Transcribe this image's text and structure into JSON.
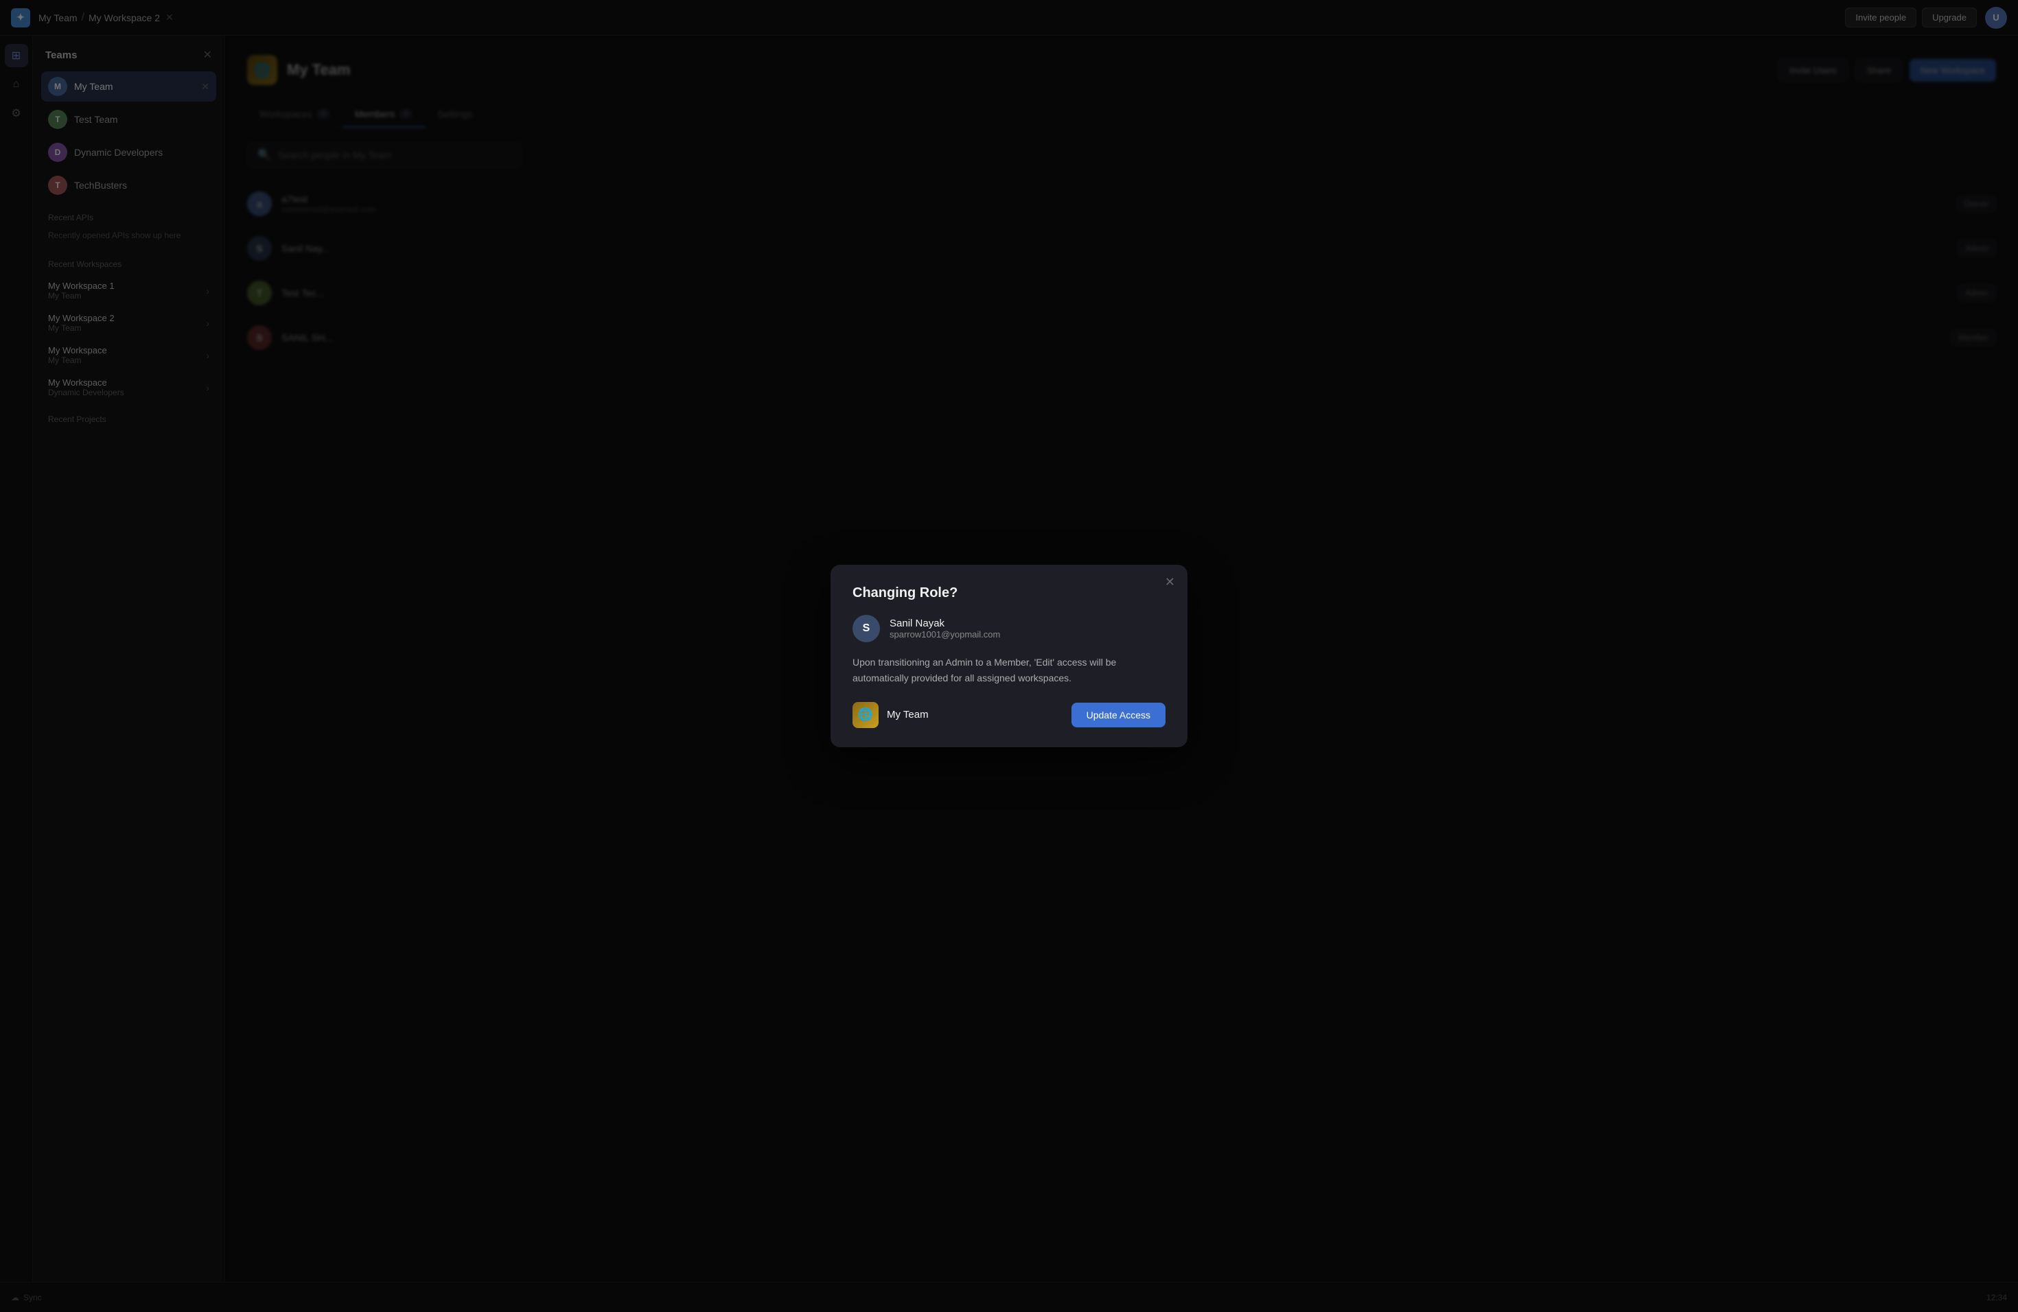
{
  "topbar": {
    "logo": "✦",
    "breadcrumb_team": "My Team",
    "breadcrumb_sep": "/",
    "breadcrumb_workspace": "My Workspace 2",
    "breadcrumb_icon": "✕",
    "invite_btn": "Invite people",
    "upgrade_btn": "Upgrade"
  },
  "sidebar": {
    "header": "Teams",
    "close_icon": "✕",
    "teams": [
      {
        "name": "My Team",
        "color": "#4a6fa5",
        "initial": "M",
        "active": true
      },
      {
        "name": "Test Team",
        "color": "#5a8a5a",
        "initial": "T"
      },
      {
        "name": "Dynamic Developers",
        "color": "#8a5aaa",
        "initial": "D"
      },
      {
        "name": "TechBusters",
        "color": "#aa5a5a",
        "initial": "T"
      }
    ],
    "recent_apis_title": "Recent APIs",
    "recent_apis_empty": "Recently opened APIs show up here",
    "recent_workspaces_title": "Recent Workspaces",
    "workspaces": [
      {
        "name": "My Workspace 1",
        "team": "My Team"
      },
      {
        "name": "My Workspace 2",
        "team": "My Team"
      },
      {
        "name": "My Workspace",
        "team": "My Team"
      },
      {
        "name": "My Workspace",
        "team": "Dynamic Developers"
      }
    ],
    "recent_projects_title": "Recent Projects"
  },
  "main": {
    "team_name": "My Team",
    "team_emoji": "🌐",
    "header_actions": {
      "invite_btn": "Invite Users",
      "share_btn": "Share",
      "new_workspace_btn": "New Workspace"
    },
    "tabs": [
      {
        "label": "Workspaces",
        "badge": "4",
        "active": false
      },
      {
        "label": "Members",
        "badge": "4",
        "active": true
      },
      {
        "label": "Settings",
        "badge": "",
        "active": false
      }
    ],
    "search_placeholder": "Search people in My Team",
    "members": [
      {
        "name": "a7test",
        "email": "someemail@testmail.com",
        "role": "Owner",
        "color": "#5a7bbf",
        "initial": "a"
      },
      {
        "name": "Sanil Nay...",
        "email": "",
        "role": "Admin",
        "color": "#3a4a6a",
        "initial": "S"
      },
      {
        "name": "Test Tec...",
        "email": "",
        "role": "Admin",
        "color": "#6a8a3a",
        "initial": "T"
      },
      {
        "name": "SANIL SH...",
        "email": "",
        "role": "Member",
        "color": "#8a3a3a",
        "initial": "S"
      }
    ]
  },
  "modal": {
    "title": "Changing Role?",
    "close_icon": "✕",
    "user": {
      "initial": "S",
      "name": "Sanil Nayak",
      "email": "sparrow1001@yopmail.com"
    },
    "description": "Upon transitioning an Admin to a Member, 'Edit' access will be automatically provided for all assigned workspaces.",
    "team_name": "My Team",
    "team_emoji": "🌐",
    "update_btn": "Update Access"
  },
  "bottombar": {
    "icon1": "☁",
    "label1": "Sync",
    "time": "12:34"
  },
  "icons": {
    "search": "🔍",
    "gear": "⚙",
    "close": "✕",
    "chevron_right": "›",
    "plus": "+",
    "arrow": "→"
  }
}
